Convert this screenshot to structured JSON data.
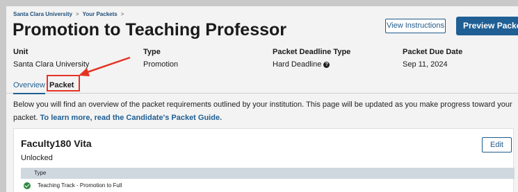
{
  "breadcrumb": {
    "items": [
      "Santa Clara University",
      "Your Packets"
    ],
    "separator": ">"
  },
  "page_title": "Promotion to Teaching Professor",
  "buttons": {
    "view_instructions": "View Instructions",
    "preview_packet": "Preview Packet"
  },
  "meta": {
    "unit": {
      "label": "Unit",
      "value": "Santa Clara University"
    },
    "type": {
      "label": "Type",
      "value": "Promotion"
    },
    "deadline_type": {
      "label": "Packet Deadline Type",
      "value": "Hard Deadline"
    },
    "due_date": {
      "label": "Packet Due Date",
      "value": "Sep 11, 2024"
    }
  },
  "tabs": {
    "overview": "Overview",
    "packet": "Packet"
  },
  "intro": {
    "text": "Below you will find an overview of the packet requirements outlined by your institution. This page will be updated as you make progress toward your packet. ",
    "link": "To learn more, read the Candidate's Packet Guide."
  },
  "card": {
    "title": "Faculty180 Vita",
    "status": "Unlocked",
    "edit_label": "Edit",
    "table": {
      "header": "Type",
      "rows": [
        "Teaching Track - Promotion to Full"
      ]
    }
  },
  "colors": {
    "accent": "#1f5f94",
    "annotation": "#e53323",
    "success": "#2d8a3f"
  }
}
